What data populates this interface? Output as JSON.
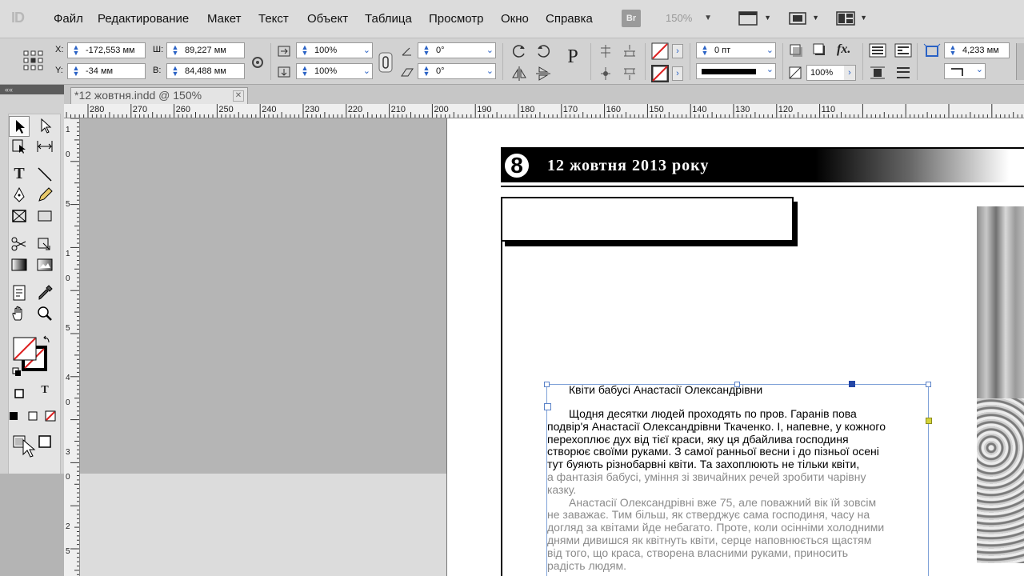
{
  "app": {
    "logo": "ID"
  },
  "menu": {
    "items": [
      "Файл",
      "Редактирование",
      "Макет",
      "Текст",
      "Объект",
      "Таблица",
      "Просмотр",
      "Окно",
      "Справка"
    ],
    "bridge_label": "Br",
    "zoom": "150%"
  },
  "control_panel": {
    "x_label": "X:",
    "x_value": "-172,553 мм",
    "y_label": "Y:",
    "y_value": "-34 мм",
    "w_label": "Ш:",
    "w_value": "89,227 мм",
    "h_label": "В:",
    "h_value": "84,488 мм",
    "scale_x": "100%",
    "scale_y": "100%",
    "rotate": "0°",
    "shear": "0°",
    "stroke_weight": "0 пт",
    "opacity": "100%",
    "size_right": "4,233 мм",
    "fx_label": "fx.",
    "p_label": "P"
  },
  "document": {
    "tab_title": "*12 жовтня.indd @ 150%",
    "ruler_h": [
      "280",
      "270",
      "260",
      "250",
      "240",
      "230",
      "220",
      "210",
      "200",
      "190",
      "180",
      "170",
      "160",
      "150",
      "140",
      "130",
      "120",
      "110"
    ],
    "ruler_v": [
      "1",
      "0",
      "",
      "5",
      "",
      "1",
      "0",
      "",
      "5",
      "",
      "4",
      "0",
      "",
      "3",
      "0",
      "",
      "2",
      "5"
    ]
  },
  "page": {
    "page_number": "8",
    "issue_date": "12 жовтня 2013 року",
    "article_heading": "Квіти бабусі Анастасії Олександрівни",
    "article_lines_dark": [
      "Щодня десятки людей проходять по пров. Гаранів пова",
      "подвір'я Анастасії Олександрівни Ткаченко. І, напевне, у кожного",
      "перехоплює дух від тієї краси, яку ця дбайлива господиня",
      "створює своїми руками. З самої ранньої весни і до пізньої осені",
      "тут буяють різнобарвні квіти. Та захоплюють не тільки квіти,"
    ],
    "article_lines_grey": [
      "а фантазія бабусі, уміння зі звичайних речей зробити чарівну",
      "казку.",
      "Анастасії Олександрівні вже 75, але поважний вік їй зовсім",
      "не заважає. Тим більш, як стверджує сама господиня, часу на",
      "догляд за квітами йде небагато. Проте, коли осінніми холодними",
      "днями дивишся як квітнуть квіти, серце наповнюється щастям",
      "від того, що краса, створена власними руками, приносить",
      "радість людям."
    ]
  },
  "colors": {
    "selection": "#7fa2d8",
    "anchor_handle": "#2346a6",
    "overflow_handle": "#d4d43a",
    "spin_arrows": "#2a62c5"
  }
}
